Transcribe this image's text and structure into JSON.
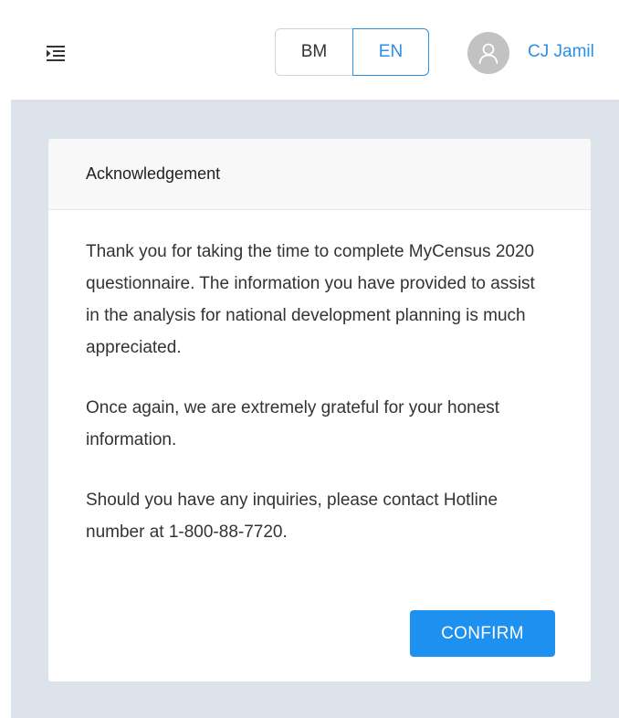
{
  "header": {
    "menu_icon": "indent-menu-icon",
    "languages": [
      "BM",
      "EN"
    ],
    "selected_language": "EN",
    "user": {
      "avatar_icon": "user-icon",
      "name": "CJ Jamil"
    }
  },
  "card": {
    "title": "Acknowledgement",
    "paragraphs": [
      "Thank you for taking the time to complete MyCensus 2020 questionnaire. The information you have provided to assist in the analysis for national development planning is much appreciated.",
      "Once again, we are extremely grateful for your honest information.",
      "Should you have any inquiries, please contact Hotline number at 1-800-88-7720."
    ],
    "confirm_label": "CONFIRM"
  },
  "colors": {
    "accent": "#1e90f0",
    "link": "#2a8fe6",
    "page_background": "#dde3ea",
    "avatar_background": "#c2c2c2"
  }
}
